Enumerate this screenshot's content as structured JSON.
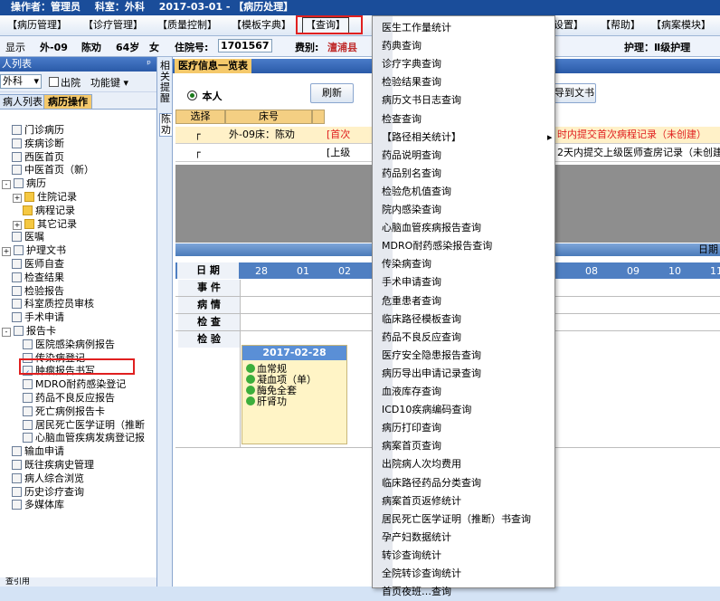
{
  "title_bar": {
    "operator": "操作者：管理员",
    "dept": "科室：外科",
    "date_mode": "2017-03-01 - 【病历处理】"
  },
  "menu": {
    "items": [
      "【病历管理】",
      "【诊疗管理】",
      "【质量控制】",
      "【模板字典】",
      "【查询】",
      "设置】",
      "【帮助】",
      "【病案模块】"
    ]
  },
  "patient_bar": {
    "mode": "显示",
    "bed": "外-09",
    "name": "陈劝",
    "age": "64岁",
    "sex": "女",
    "inpatient_label": "住院号:",
    "inpatient_no": "1701567",
    "fee_label": "费别:",
    "fee_value": "澶浦县",
    "nursing": "护理：Ⅱ级护理"
  },
  "left_panel": {
    "header": "人列表",
    "pin": "ᵖ",
    "dept_select": "外科",
    "discharge_label": "出院",
    "function_label": "功能键",
    "tab_patient_list": "病人列表",
    "tab_record_ops": "病历操作",
    "tree": [
      {
        "label": "门诊病历",
        "level": 0,
        "icon": "doc"
      },
      {
        "label": "疾病诊断",
        "level": 0,
        "icon": "doc"
      },
      {
        "label": "西医首页",
        "level": 0,
        "icon": "doc"
      },
      {
        "label": "中医首页（新）",
        "level": 0,
        "icon": "doc"
      },
      {
        "label": "病历",
        "level": 0,
        "icon": "doc",
        "exp": "-"
      },
      {
        "label": "住院记录",
        "level": 1,
        "icon": "folder",
        "exp": "+"
      },
      {
        "label": "病程记录",
        "level": 1,
        "icon": "folder"
      },
      {
        "label": "其它记录",
        "level": 1,
        "icon": "folder",
        "exp": "+"
      },
      {
        "label": "医嘱",
        "level": 0,
        "icon": "doc"
      },
      {
        "label": "护理文书",
        "level": 0,
        "icon": "doc",
        "exp": "+"
      },
      {
        "label": "医师自查",
        "level": 0,
        "icon": "doc"
      },
      {
        "label": "检查结果",
        "level": 0,
        "icon": "doc"
      },
      {
        "label": "检验报告",
        "level": 0,
        "icon": "doc"
      },
      {
        "label": "科室质控员审核",
        "level": 0,
        "icon": "doc"
      },
      {
        "label": "手术申请",
        "level": 0,
        "icon": "doc"
      },
      {
        "label": "报告卡",
        "level": 0,
        "icon": "doc",
        "exp": "-"
      },
      {
        "label": "医院感染病例报告",
        "level": 1,
        "icon": "doc"
      },
      {
        "label": "传染病登记",
        "level": 1,
        "icon": "doc"
      },
      {
        "label": "肿瘤报告书写",
        "level": 1,
        "icon": "check"
      },
      {
        "label": "MDRO耐药感染登记",
        "level": 1,
        "icon": "doc"
      },
      {
        "label": "药品不良反应报告",
        "level": 1,
        "icon": "doc"
      },
      {
        "label": "死亡病例报告卡",
        "level": 1,
        "icon": "doc"
      },
      {
        "label": "居民死亡医学证明（推断",
        "level": 1,
        "icon": "doc"
      },
      {
        "label": "心脑血管疾病发病登记报",
        "level": 1,
        "icon": "doc"
      },
      {
        "label": "输血申请",
        "level": 0,
        "icon": "doc"
      },
      {
        "label": "既往疾病史管理",
        "level": 0,
        "icon": "doc"
      },
      {
        "label": "病人综合浏览",
        "level": 0,
        "icon": "doc"
      },
      {
        "label": "历史诊疗查询",
        "level": 0,
        "icon": "doc"
      },
      {
        "label": "多媒体库",
        "level": 0,
        "icon": "doc"
      }
    ],
    "footer": "查引用"
  },
  "vtab": {
    "related": "相关提醒",
    "patient": "陈劝"
  },
  "main": {
    "title": "医疗信息一览表",
    "radio_self": "本人",
    "refresh_btn": "刷新",
    "to_doc_btn": "导到文书",
    "grid_headers": [
      "选择",
      "床号"
    ],
    "rows": [
      {
        "bed": "外-09床：陈劝",
        "msg_left": "[首次",
        "msg_right": "时内提交首次病程记录（未创建）"
      },
      {
        "bed": "",
        "msg_left": "[上级",
        "msg_right": "2天内提交上级医师查房记录（未创建"
      }
    ],
    "date_row_label": "日 期",
    "dates": [
      "28",
      "01",
      "02",
      "08",
      "09",
      "10",
      "11"
    ],
    "week_label": "日期",
    "row_labels": [
      "事 件",
      "病 情",
      "检 查",
      "检 验"
    ],
    "card_date": "2017-02-28",
    "card_items": [
      "血常规",
      "凝血项（单）",
      "酶免全套",
      "肝肾功"
    ]
  },
  "dropdown": {
    "items": [
      "医生工作量统计",
      "药典查询",
      "诊疗字典查询",
      "检验结果查询",
      "病历文书日志查询",
      "检查查询",
      "【路径相关统计】",
      "药品说明查询",
      "药品别名查询",
      "检验危机值查询",
      "院内感染查询",
      "心脑血管疾病报告查询",
      "MDRO耐药感染报告查询",
      "传染病查询",
      "手术申请查询",
      "危重患者查询",
      "临床路径模板查询",
      "药品不良反应查询",
      "医疗安全隐患报告查询",
      "病历导出申请记录查询",
      "血液库存查询",
      "ICD10疾病编码查询",
      "病历打印查询",
      "病案首页查询",
      "出院病人次均费用",
      "临床路径药品分类查询",
      "病案首页返修统计",
      "居民死亡医学证明（推断）书查询",
      "孕产妇数据统计",
      "转诊查询统计",
      "全院转诊查询统计",
      "首页夜班…查询"
    ],
    "submenu_arrow": "▸"
  },
  "colors": {
    "accent": "#1a4d9a",
    "highlight": "#e02020",
    "tab_selected": "#f5c96b"
  }
}
